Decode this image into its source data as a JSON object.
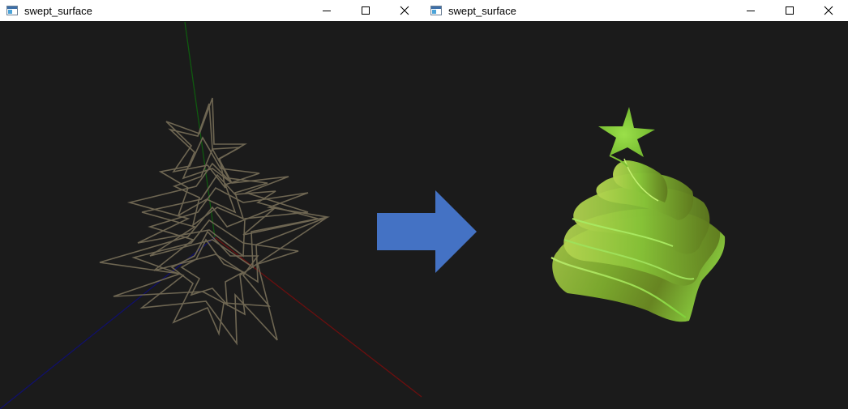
{
  "windows": [
    {
      "title": "swept_surface"
    },
    {
      "title": "swept_surface"
    }
  ],
  "icons": {
    "app": "app-window-icon",
    "minimize": "minimize-icon",
    "maximize": "maximize-icon",
    "close": "close-icon",
    "arrow": "right-arrow-icon"
  },
  "colors": {
    "background": "#1b1b1b",
    "titlebar": "#ffffff",
    "wireframe": "#6e6652",
    "axis_x": "#6a0f0f",
    "axis_y": "#0f5a0f",
    "axis_z": "#10106a",
    "arrow": "#4472c4",
    "surface_light": "#8fd33a",
    "surface_dark": "#5f7a1e"
  }
}
